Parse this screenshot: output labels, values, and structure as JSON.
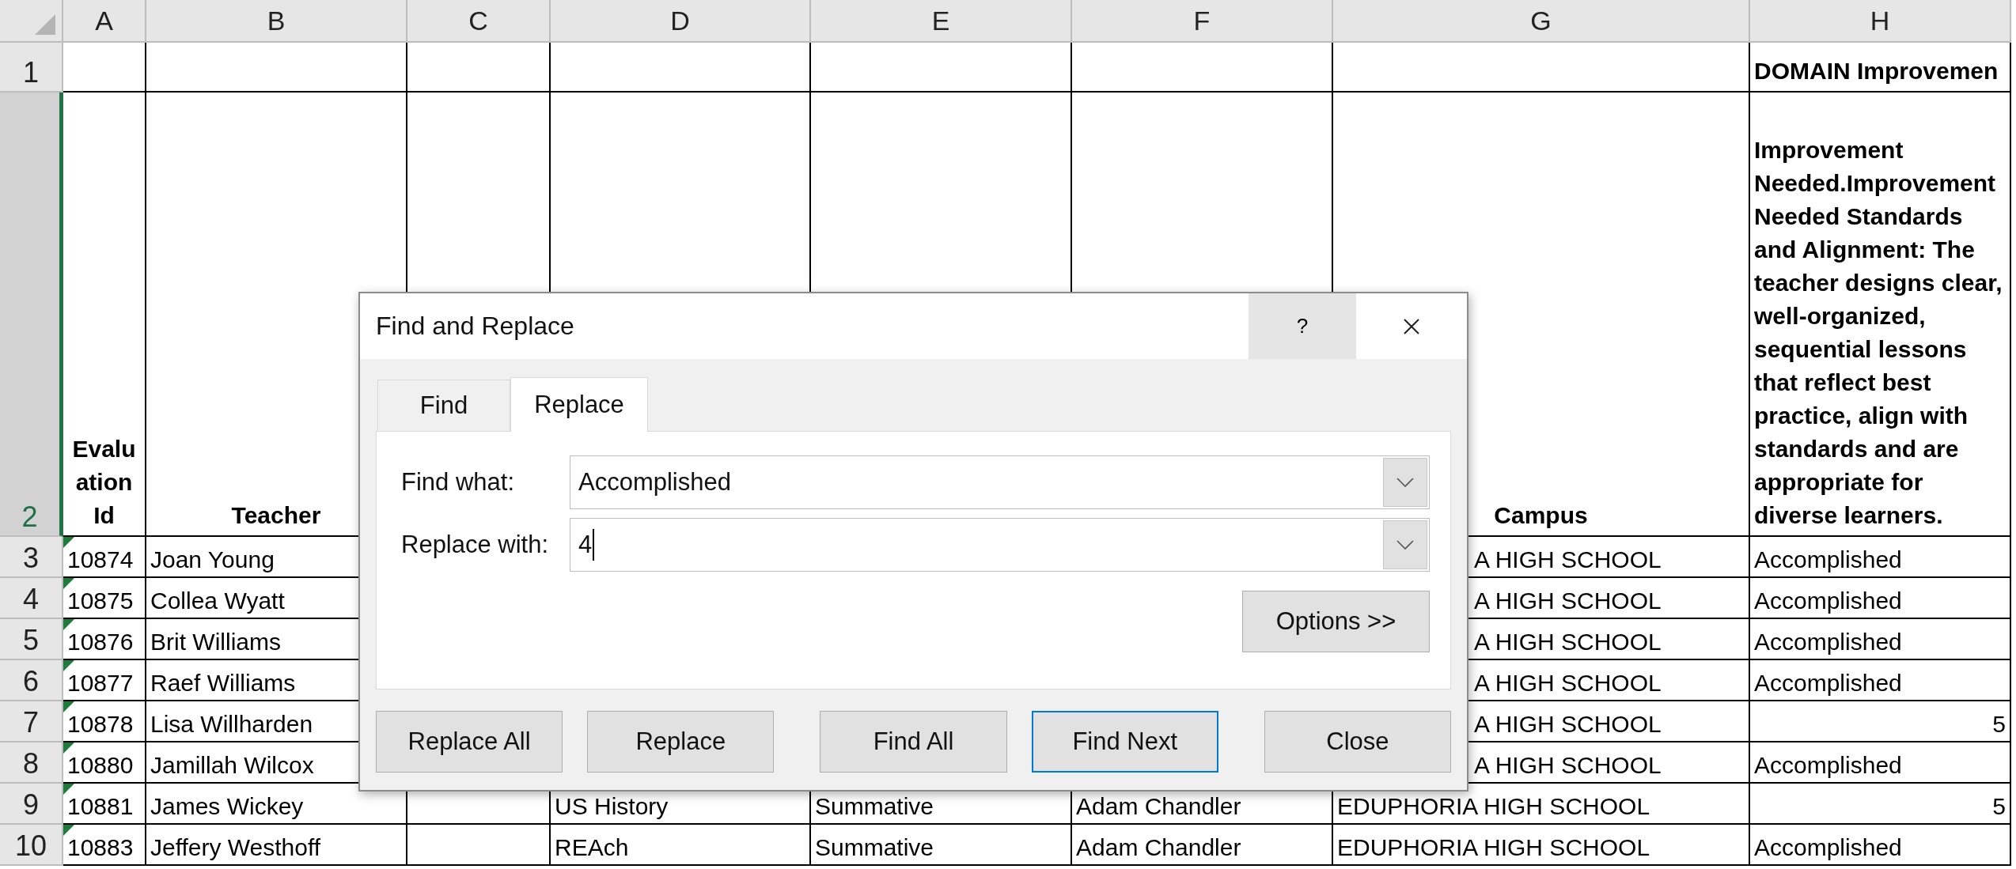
{
  "sheet": {
    "columns": [
      "A",
      "B",
      "C",
      "D",
      "E",
      "F",
      "G",
      "H"
    ],
    "rows": [
      {
        "number": "1",
        "selected": false,
        "kind": "header",
        "cells": [
          null,
          null,
          null,
          null,
          null,
          null,
          null,
          {
            "text": "DOMAIN Improvemen",
            "kind": "overflow"
          }
        ]
      },
      {
        "number": "2",
        "selected": true,
        "kind": "header",
        "cells": [
          {
            "text": "Evaluation Id",
            "kind": "centered"
          },
          {
            "text": "Teacher",
            "kind": "centered"
          },
          null,
          null,
          null,
          null,
          {
            "text": "Campus",
            "kind": "centered"
          },
          {
            "text": "Improvement Needed.Improvement Needed Standards and Alignment: The teacher designs clear, well-organized, sequential lessons that reflect best practice, align with standards and are appropriate for diverse learners.",
            "kind": "wrapped"
          }
        ]
      },
      {
        "number": "3",
        "selected": false,
        "kind": "data",
        "cells": [
          {
            "text": "10874",
            "kind": "flagged"
          },
          "Joan Young",
          null,
          null,
          null,
          null,
          {
            "text": "A HIGH SCHOOL",
            "kind": "covered"
          },
          "Accomplished"
        ]
      },
      {
        "number": "4",
        "selected": false,
        "kind": "data",
        "cells": [
          {
            "text": "10875",
            "kind": "flagged"
          },
          "Collea Wyatt",
          null,
          null,
          null,
          null,
          {
            "text": "A HIGH SCHOOL",
            "kind": "covered"
          },
          "Accomplished"
        ]
      },
      {
        "number": "5",
        "selected": false,
        "kind": "data",
        "cells": [
          {
            "text": "10876",
            "kind": "flagged"
          },
          "Brit Williams",
          null,
          null,
          null,
          null,
          {
            "text": "A HIGH SCHOOL",
            "kind": "covered"
          },
          "Accomplished"
        ]
      },
      {
        "number": "6",
        "selected": false,
        "kind": "data",
        "cells": [
          {
            "text": "10877",
            "kind": "flagged"
          },
          "Raef Williams",
          null,
          null,
          null,
          null,
          {
            "text": "A HIGH SCHOOL",
            "kind": "covered"
          },
          "Accomplished"
        ]
      },
      {
        "number": "7",
        "selected": false,
        "kind": "data",
        "cells": [
          {
            "text": "10878",
            "kind": "flagged"
          },
          "Lisa Willharden",
          null,
          null,
          null,
          null,
          {
            "text": "A HIGH SCHOOL",
            "kind": "covered"
          },
          {
            "text": "5",
            "kind": "number"
          }
        ]
      },
      {
        "number": "8",
        "selected": false,
        "kind": "data",
        "cells": [
          {
            "text": "10880",
            "kind": "flagged"
          },
          "Jamillah Wilcox",
          null,
          null,
          null,
          null,
          {
            "text": "A HIGH SCHOOL",
            "kind": "covered"
          },
          "Accomplished"
        ]
      },
      {
        "number": "9",
        "selected": false,
        "kind": "data",
        "cells": [
          {
            "text": "10881",
            "kind": "flagged"
          },
          "James Wickey",
          null,
          "US History",
          "Summative",
          "Adam Chandler",
          "EDUPHORIA HIGH SCHOOL",
          {
            "text": "5",
            "kind": "number"
          }
        ]
      },
      {
        "number": "10",
        "selected": false,
        "kind": "data",
        "cells": [
          {
            "text": "10883",
            "kind": "flagged"
          },
          "Jeffery Westhoff",
          null,
          "REAch",
          "Summative",
          "Adam Chandler",
          "EDUPHORIA HIGH SCHOOL",
          "Accomplished"
        ]
      }
    ]
  },
  "dialog": {
    "title": "Find and Replace",
    "help": "?",
    "tabs": [
      {
        "label": "Find",
        "selected": false
      },
      {
        "label": "Replace",
        "selected": true
      }
    ],
    "fields": [
      {
        "label": "Find what:",
        "value": "Accomplished",
        "focused": false
      },
      {
        "label": "Replace with:",
        "value": "4",
        "focused": true
      }
    ],
    "options_button": "Options >>",
    "buttons": [
      {
        "label": "Replace All",
        "default": false
      },
      {
        "label": "Replace",
        "default": false
      },
      {
        "label": "Find All",
        "default": false
      },
      {
        "label": "Find Next",
        "default": true
      },
      {
        "label": "Close",
        "default": false
      }
    ]
  }
}
